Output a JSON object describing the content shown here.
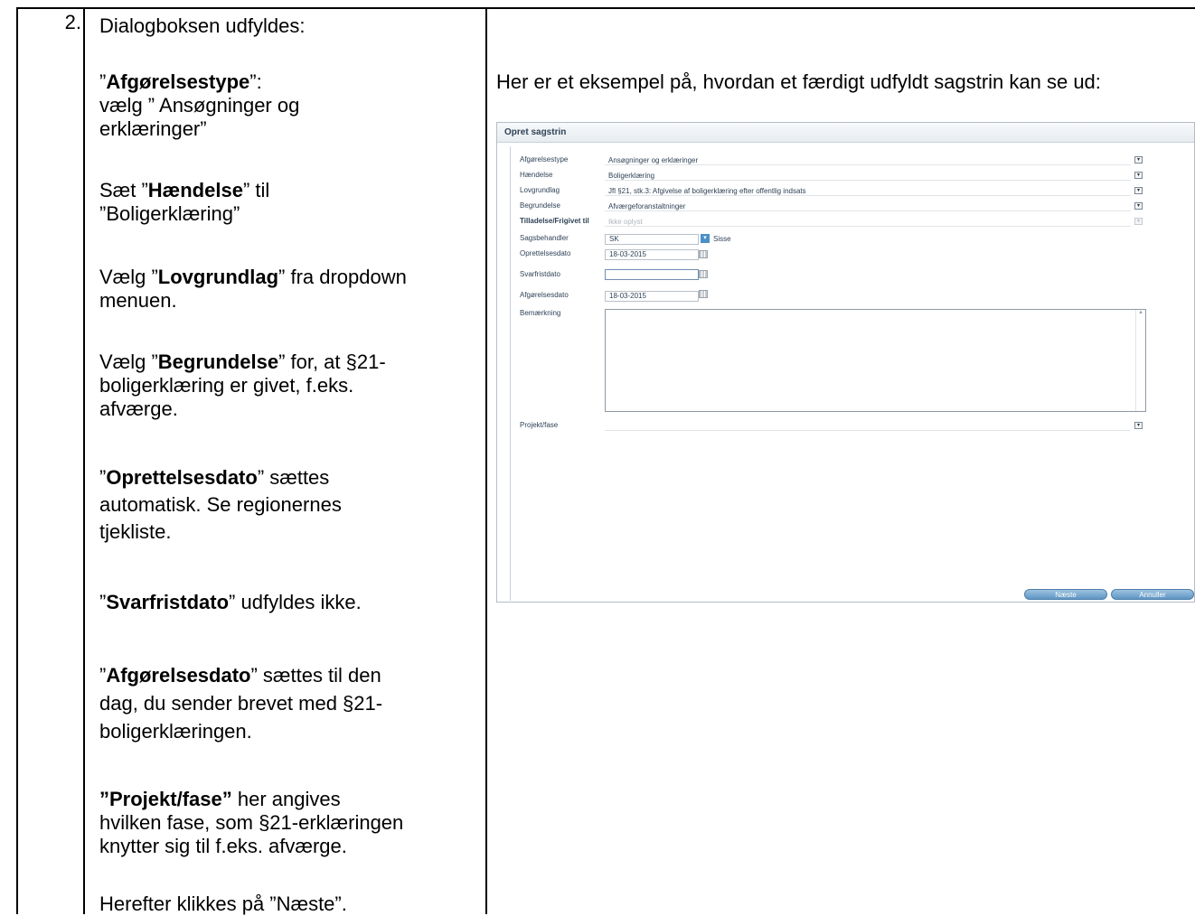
{
  "step_number": "2.",
  "instructions": {
    "intro": "Dialogboksen udfyldes:",
    "afgorelsestype": {
      "q_open": "”",
      "name": "Afgørelsestype",
      "suffix": "”:",
      "line2": "vælg ” Ansøgninger og",
      "line3": "erklæringer”"
    },
    "haendelse": {
      "prefix": "Sæt ”",
      "name": "Hændelse",
      "suffix": "” til",
      "line2": "”Boligerklæring”"
    },
    "lovgrundlag": {
      "prefix": "Vælg ”",
      "name": "Lovgrundlag",
      "suffix": "” fra dropdown",
      "line2": "menuen."
    },
    "begrundelse": {
      "prefix": "Vælg ”",
      "name": "Begrundelse",
      "suffix": "” for, at §21-",
      "line2": "boligerklæring er givet, f.eks.",
      "line3": "afværge."
    },
    "oprettelsesdato": {
      "q_open": "”",
      "name": "Oprettelsesdato",
      "suffix": "” sættes",
      "line2": "automatisk. Se regionernes",
      "line3": "tjekliste."
    },
    "svarfristdato": {
      "q_open": "”",
      "name": "Svarfristdato",
      "suffix": "” udfyldes ikke."
    },
    "afgorelsesdato": {
      "q_open": "”",
      "name": "Afgørelsesdato",
      "suffix": "” sættes til den",
      "line2": "dag, du sender brevet med §21-",
      "line3": "boligerklæringen."
    },
    "projekt": {
      "name": "”Projekt/fase”",
      "suffix": " her angives",
      "line2": "hvilken fase, som §21-erklæringen",
      "line3": "knytter sig til f.eks. afværge."
    },
    "final": "Herefter klikkes på ”Næste”."
  },
  "right_intro": "Her er et eksempel på, hvordan et færdigt udfyldt sagstrin kan se ud:",
  "dialog": {
    "title": "Opret sagstrin",
    "fields": {
      "afgorelsestype": {
        "label": "Afgørelsestype",
        "value": "Ansøgninger og erklæringer"
      },
      "haendelse": {
        "label": "Hændelse",
        "value": "Boligerklæring"
      },
      "lovgrundlag": {
        "label": "Lovgrundlag",
        "value": "Jfl §21, stk.3: Afgivelse af boligerklæring efter offentlig indsats"
      },
      "begrundelse": {
        "label": "Begrundelse",
        "value": "Afværgeforanstaltninger"
      },
      "tilladelse": {
        "label": "Tilladelse/Frigivet til",
        "value": "Ikke oplyst"
      },
      "sagsbehandler": {
        "label": "Sagsbehandler",
        "value": "SK",
        "name": "Sisse"
      },
      "oprettelsesdato": {
        "label": "Oprettelsesdato",
        "value": "18-03-2015"
      },
      "svarfristdato": {
        "label": "Svarfristdato",
        "value": ""
      },
      "afgorelsesdato": {
        "label": "Afgørelsesdato",
        "value": "18-03-2015"
      },
      "bemaerkning": {
        "label": "Bemærkning",
        "value": ""
      },
      "projekt": {
        "label": "Projekt/fase",
        "value": ""
      }
    },
    "buttons": {
      "next": "Næste",
      "cancel": "Annuller"
    }
  }
}
